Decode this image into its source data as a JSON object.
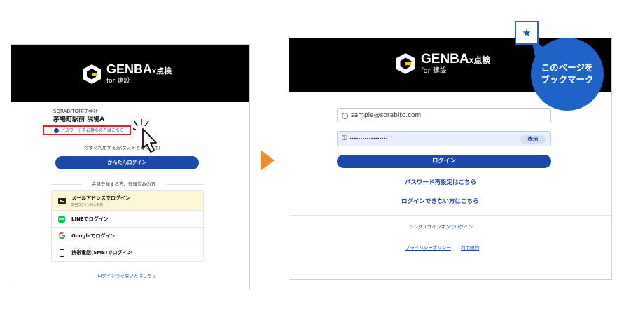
{
  "left": {
    "logo_word": "GENBA",
    "logo_suffix": "x点検",
    "logo_sub": "for 建設",
    "company": "SORABITO株式会社",
    "site": "茅場町駅前  現場A",
    "password_link": "パスワードをお持ちの方はこちら",
    "guest_heading": "今すぐ利用する方(ゲストとして利用)",
    "easy_login": "かんたんログイン",
    "registered_heading": "会員登録する方、登録済みの方",
    "options": [
      {
        "label": "メールアドレスでログイン",
        "sub": "前回ログイン時に利用",
        "icon": "id-card-icon"
      },
      {
        "label": "LINEでログイン",
        "icon": "line-icon"
      },
      {
        "label": "Googleでログイン",
        "icon": "google-icon"
      },
      {
        "label": "携帯電話(SMS)でログイン",
        "icon": "mobile-phone-icon"
      }
    ],
    "cannot_login": "ログインできない方はこちら"
  },
  "right": {
    "logo_word": "GENBA",
    "logo_suffix": "x点検",
    "logo_sub": "for 建設",
    "email_value": "sample@sorabito.com",
    "password_mask": "••••••••••••••••••",
    "show_button": "表示",
    "login_button": "ログイン",
    "reset_link": "パスワード再設定はこちら",
    "cannot_login": "ログインできない方はこちら",
    "sso": "シングルサインオンでログイン",
    "privacy": "プライバシーポリシー",
    "terms": "利用規約"
  },
  "bubble": {
    "line1": "このページを",
    "line2": "ブックマーク"
  },
  "colors": {
    "primary_blue": "#1c4aa8",
    "arrow_orange": "#ef8b2c",
    "highlight_red": "#e0262b",
    "bubble_blue": "#1f63c9"
  }
}
